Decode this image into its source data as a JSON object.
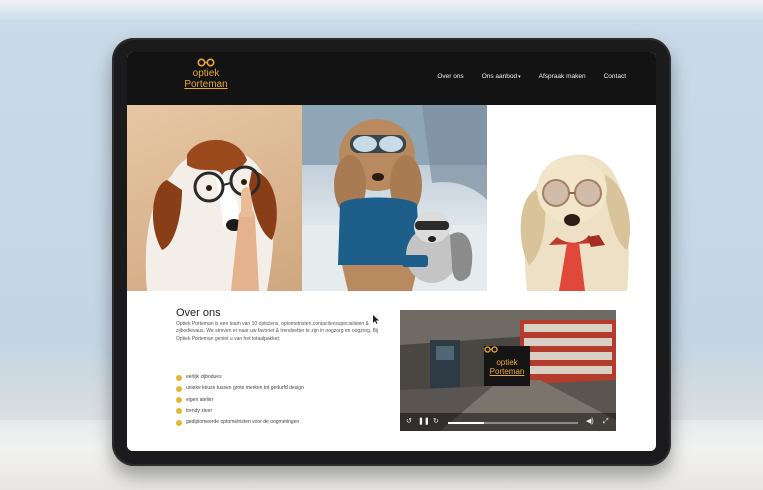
{
  "nav": {
    "logo_line1": "optiek",
    "logo_line2": "Porteman",
    "links": [
      {
        "label": "Over ons"
      },
      {
        "label": "Ons aanbod",
        "caret": "▾"
      },
      {
        "label": "Afspraak maken"
      },
      {
        "label": "Contact"
      }
    ]
  },
  "about": {
    "title": "Over ons",
    "text": "Optiek Porteman is een team van 10 opticiens, optometristen,contactlensspecialisten & zijbodievaus. We streven er naar uw favoriet & trendsetter te zijn in oogzorg en oogzorg. Bij Optiek Porteman geniet u van het totaalpakket:",
    "bullets": [
      "eerlijk zijbodues",
      "unieke keuze tussen grote merken tot gedurfd design",
      "eigen atelier",
      "trendy zieer",
      "gediplomeerde optometristen voor de oogmetingen"
    ]
  },
  "video": {
    "logo_line1": "optiek",
    "logo_line2": "Porteman",
    "progress": 0.28,
    "icons": [
      "rewind-icon",
      "pause-icon",
      "forward-icon",
      "volume-icon",
      "fullscreen-icon"
    ]
  },
  "colors": {
    "accent": "#e9a73b",
    "bullet": "#e0b830",
    "nav_bg": "#131313"
  }
}
